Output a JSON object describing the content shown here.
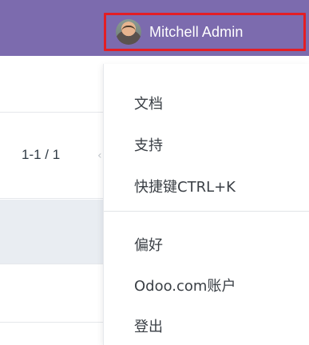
{
  "navbar": {
    "user_name": "Mitchell Admin",
    "user_avatar": "user-avatar"
  },
  "list": {
    "pager_text": "1-1 / 1"
  },
  "menu": {
    "items": [
      {
        "label": "文档"
      },
      {
        "label": "支持"
      },
      {
        "label": "快捷键CTRL+K"
      },
      {
        "label": "偏好"
      },
      {
        "label": "Odoo.com账户"
      },
      {
        "label": "登出"
      }
    ]
  },
  "colors": {
    "navbar_bg": "#7c6bae",
    "highlight_border": "#e31e24",
    "row_grey": "#e9edf2"
  }
}
